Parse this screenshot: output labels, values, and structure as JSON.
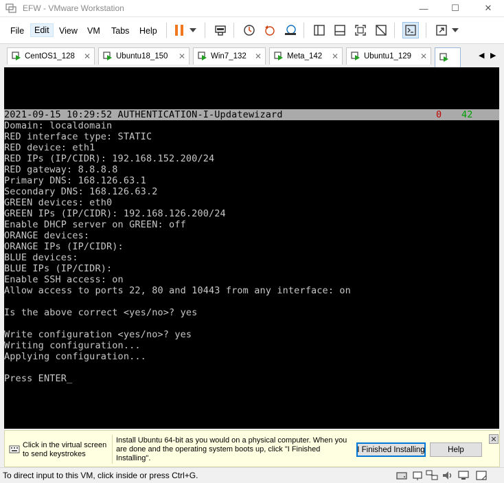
{
  "window": {
    "title": "EFW - VMware Workstation",
    "controls": {
      "minimize": "—",
      "maximize": "☐",
      "close": "✕"
    }
  },
  "menu": {
    "items": [
      "File",
      "Edit",
      "View",
      "VM",
      "Tabs",
      "Help"
    ]
  },
  "toolbar": {
    "icons": [
      "pause-icon",
      "dropdown-arrow-icon",
      "send-ctrl-alt-del-icon",
      "snapshot-take-icon",
      "snapshot-revert-icon",
      "snapshot-manager-icon",
      "sidebar-toggle-icon",
      "thumbnail-bar-icon",
      "fullscreen-icon",
      "unity-icon",
      "console-view-icon",
      "stretch-icon",
      "dropdown-arrow-icon"
    ]
  },
  "tabs": [
    {
      "label": "CentOS1_128",
      "close": "✕"
    },
    {
      "label": "Ubuntu18_150",
      "close": "✕"
    },
    {
      "label": "Win7_132",
      "close": "✕"
    },
    {
      "label": "Meta_142",
      "close": "✕"
    },
    {
      "label": "Ubuntu1_129",
      "close": "✕"
    }
  ],
  "tab_nav": {
    "prev": "◀",
    "next": "▶"
  },
  "console": {
    "status_line": {
      "text": "2021-09-15 10:29:52 AUTHENTICATION-I-Updatewizard",
      "red_value": "0",
      "green_value": "42"
    },
    "lines": [
      "Domain: localdomain",
      "RED interface type: STATIC",
      "RED device: eth1",
      "RED IPs (IP/CIDR): 192.168.152.200/24",
      "RED gateway: 8.8.8.8",
      "Primary DNS: 168.126.63.1",
      "Secondary DNS: 168.126.63.2",
      "GREEN devices: eth0",
      "GREEN IPs (IP/CIDR): 192.168.126.200/24",
      "Enable DHCP server on GREEN: off",
      "ORANGE devices:",
      "ORANGE IPs (IP/CIDR):",
      "BLUE devices:",
      "BLUE IPs (IP/CIDR):",
      "Enable SSH access: on",
      "Allow access to ports 22, 80 and 10443 from any interface: on",
      "",
      "Is the above correct <yes/no>? yes",
      "",
      "Write configuration <yes/no>? yes",
      "Writing configuration...",
      "Applying configuration...",
      "",
      "Press ENTER_"
    ]
  },
  "hint": {
    "left_text": "Click in the virtual screen to send keystrokes",
    "main_text": "Install Ubuntu 64-bit as you would on a physical computer. When you are done and the operating system boots up, click \"I Finished Installing\".",
    "finished_button": "I Finished Installing",
    "help_button": "Help",
    "close": "✕"
  },
  "statusbar": {
    "message": "To direct input to this VM, click inside or press Ctrl+G.",
    "icons": [
      "hard-disk-icon",
      "network-icon",
      "network-adapter-icon",
      "sound-icon",
      "display-icon",
      "message-icon"
    ]
  }
}
